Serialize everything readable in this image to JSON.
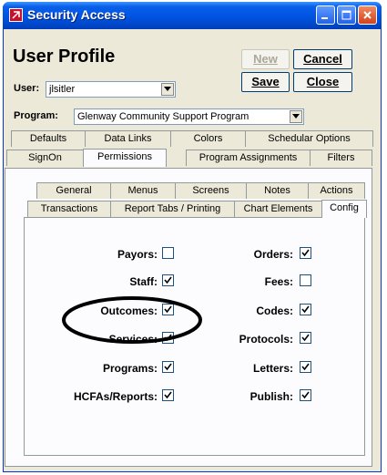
{
  "window": {
    "title": "Security Access",
    "icon": "app-icon",
    "controls": [
      "minimize-icon",
      "maximize-icon",
      "close-icon"
    ]
  },
  "header": {
    "title": "User Profile",
    "user_label": "User:",
    "user_value": "jlsitler",
    "program_label": "Program:",
    "program_value": "Glenway Community Support Program",
    "buttons": {
      "new": "New",
      "cancel": "Cancel",
      "save": "Save",
      "close": "Close"
    }
  },
  "tabs_top": {
    "row1": [
      "Defaults",
      "Data Links",
      "Colors",
      "Schedular Options"
    ],
    "row2": [
      "SignOn",
      "Permissions",
      "Program Assignments",
      "Filters"
    ],
    "active": "Permissions"
  },
  "tabs_inner": {
    "row1": [
      "General",
      "Menus",
      "Screens",
      "Notes",
      "Actions"
    ],
    "row2": [
      "Transactions",
      "Report Tabs / Printing",
      "Chart Elements",
      "Config"
    ],
    "active": "Config"
  },
  "permissions": {
    "left": [
      {
        "label": "Payors:",
        "checked": false
      },
      {
        "label": "Staff:",
        "checked": true
      },
      {
        "label": "Outcomes:",
        "checked": true
      },
      {
        "label": "Services:",
        "checked": true
      },
      {
        "label": "Programs:",
        "checked": true
      },
      {
        "label": "HCFAs/Reports:",
        "checked": true
      }
    ],
    "right": [
      {
        "label": "Orders:",
        "checked": true
      },
      {
        "label": "Fees:",
        "checked": false
      },
      {
        "label": "Codes:",
        "checked": true
      },
      {
        "label": "Protocols:",
        "checked": true
      },
      {
        "label": "Letters:",
        "checked": true
      },
      {
        "label": "Publish:",
        "checked": true
      }
    ]
  },
  "colors": {
    "title_bar": "#0055e5",
    "window_bg": "#ece9d8",
    "panel_bg": "#fcfcfe",
    "annotation": "#000000"
  }
}
